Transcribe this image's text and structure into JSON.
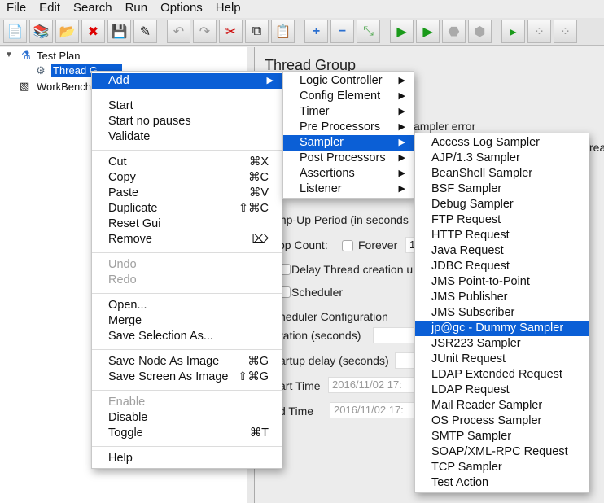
{
  "menubar": [
    "File",
    "Edit",
    "Search",
    "Run",
    "Options",
    "Help"
  ],
  "toolbar": {
    "icons": [
      "new-icon",
      "templates-icon",
      "open-icon",
      "close-icon",
      "save-icon",
      "save-as-icon",
      "undo-icon",
      "redo-icon",
      "cut-icon",
      "copy-icon",
      "paste-icon",
      "expand-icon",
      "collapse-icon",
      "toggle-icon",
      "start-icon",
      "start-no-pauses-icon",
      "stop-icon",
      "shutdown-icon",
      "remote-start-icon",
      "remote-icon",
      "remote-stop-icon"
    ]
  },
  "tree": {
    "test_plan": "Test Plan",
    "thread_group": "Thread G",
    "workbench": "WorkBench"
  },
  "panel": {
    "title": "Thread Group",
    "sampler_error": "ampler error",
    "threads_cut": "rea",
    "ramp_up": "mp-Up Period (in seconds",
    "loop_count": "op Count:",
    "forever": "Forever",
    "loop_value": "1",
    "delay": "Delay Thread creation u",
    "scheduler": "Scheduler",
    "sched_config": "heduler Configuration",
    "duration": "ration (seconds)",
    "startup_delay": "artup delay (seconds)",
    "start_time": "art Time",
    "start_value": "2016/11/02 17:",
    "end_time": "d Time",
    "end_value": "2016/11/02 17:"
  },
  "context_menu": {
    "add": "Add",
    "start": "Start",
    "start_no_pauses": "Start no pauses",
    "validate": "Validate",
    "cut": "Cut",
    "cut_sc": "⌘X",
    "copy": "Copy",
    "copy_sc": "⌘C",
    "paste": "Paste",
    "paste_sc": "⌘V",
    "duplicate": "Duplicate",
    "duplicate_sc": "⇧⌘C",
    "reset_gui": "Reset Gui",
    "remove": "Remove",
    "remove_sc": "⌦",
    "undo": "Undo",
    "redo": "Redo",
    "open": "Open...",
    "merge": "Merge",
    "save_selection": "Save Selection As...",
    "save_node_image": "Save Node As Image",
    "save_node_sc": "⌘G",
    "save_screen_image": "Save Screen As Image",
    "save_screen_sc": "⇧⌘G",
    "enable": "Enable",
    "disable": "Disable",
    "toggle": "Toggle",
    "toggle_sc": "⌘T",
    "help": "Help"
  },
  "add_menu": [
    "Logic Controller",
    "Config Element",
    "Timer",
    "Pre Processors",
    "Sampler",
    "Post Processors",
    "Assertions",
    "Listener"
  ],
  "sampler_menu": [
    "Access Log Sampler",
    "AJP/1.3 Sampler",
    "BeanShell Sampler",
    "BSF Sampler",
    "Debug Sampler",
    "FTP Request",
    "HTTP Request",
    "Java Request",
    "JDBC Request",
    "JMS Point-to-Point",
    "JMS Publisher",
    "JMS Subscriber",
    "jp@gc - Dummy Sampler",
    "JSR223 Sampler",
    "JUnit Request",
    "LDAP Extended Request",
    "LDAP Request",
    "Mail Reader Sampler",
    "OS Process Sampler",
    "SMTP Sampler",
    "SOAP/XML-RPC Request",
    "TCP Sampler",
    "Test Action"
  ],
  "colors": {
    "highlight": "#0b5fd6"
  }
}
